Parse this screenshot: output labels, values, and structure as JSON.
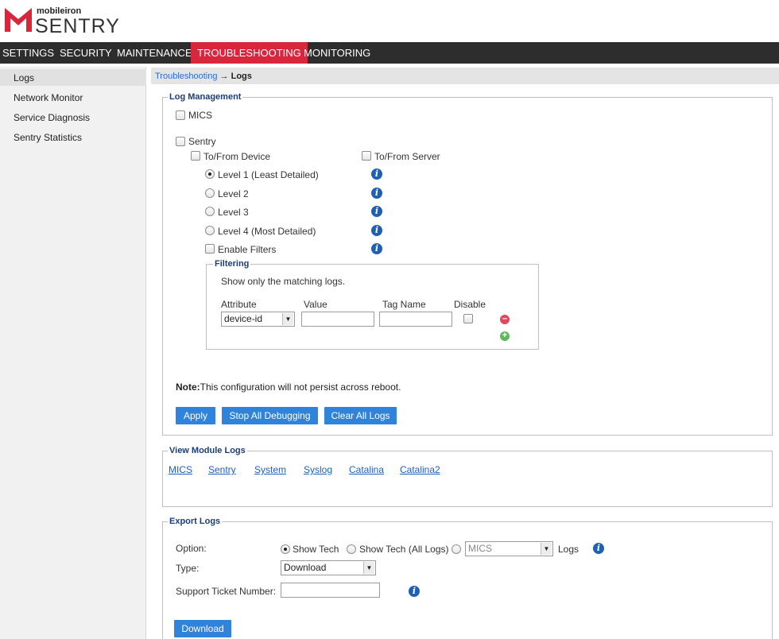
{
  "brand": {
    "top": "mobileiron",
    "product": "SENTRY"
  },
  "nav": {
    "items": [
      "SETTINGS",
      "SECURITY",
      "MAINTENANCE",
      "TROUBLESHOOTING",
      "MONITORING"
    ],
    "active": "TROUBLESHOOTING",
    "active_color": "#d8273d"
  },
  "sidebar": {
    "items": [
      "Logs",
      "Network Monitor",
      "Service Diagnosis",
      "Sentry Statistics"
    ],
    "active": "Logs"
  },
  "breadcrumb": {
    "parent": "Troubleshooting",
    "separator": "→",
    "current": "Logs"
  },
  "log_management": {
    "legend": "Log Management",
    "mics_label": "MICS",
    "sentry_label": "Sentry",
    "to_from_device": "To/From Device",
    "to_from_server": "To/From Server",
    "levels": [
      "Level 1 (Least Detailed)",
      "Level 2",
      "Level 3",
      "Level 4 (Most Detailed)"
    ],
    "selected_level": "Level 1 (Least Detailed)",
    "enable_filters": "Enable Filters",
    "filtering": {
      "legend": "Filtering",
      "description": "Show only the matching logs.",
      "headers": {
        "attribute": "Attribute",
        "value": "Value",
        "tag_name": "Tag Name",
        "disable": "Disable"
      },
      "attribute_selected": "device-id"
    },
    "note_bold": "Note:",
    "note_text": "This configuration will not persist across reboot.",
    "buttons": {
      "apply": "Apply",
      "stop": "Stop All Debugging",
      "clear": "Clear All Logs"
    }
  },
  "view_module_logs": {
    "legend": "View Module Logs",
    "links": [
      "MICS",
      "Sentry",
      "System",
      "Syslog",
      "Catalina",
      "Catalina2"
    ]
  },
  "export_logs": {
    "legend": "Export Logs",
    "option_label": "Option:",
    "options": [
      "Show Tech",
      "Show Tech (All Logs)"
    ],
    "selected_option": "Show Tech",
    "module_select": "MICS",
    "logs_suffix": "Logs",
    "type_label": "Type:",
    "type_value": "Download",
    "ticket_label": "Support Ticket Number:",
    "download_button": "Download"
  },
  "colors": {
    "button": "#2f83db",
    "legend": "#1a3e7a",
    "nav_bg": "#2d2d2d",
    "link": "#1e5fbf"
  }
}
